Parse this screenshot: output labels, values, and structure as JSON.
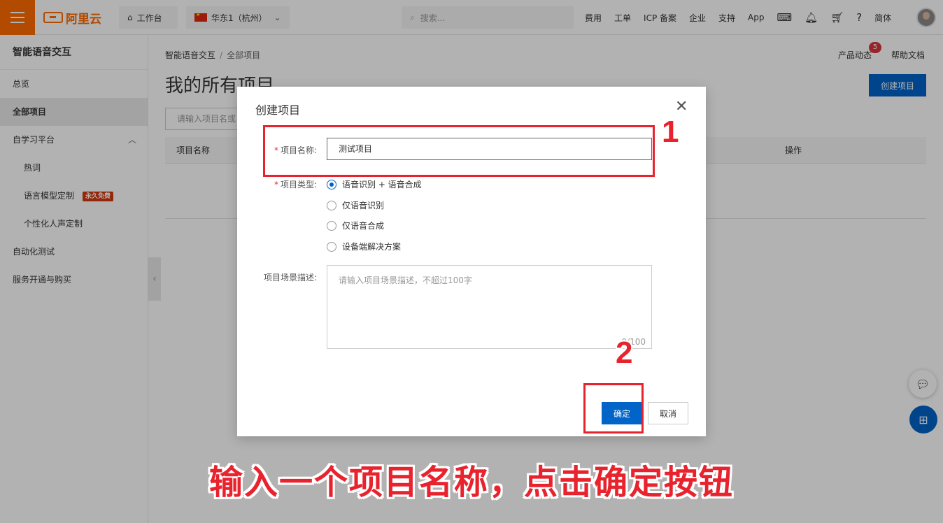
{
  "topbar": {
    "logo_text": "阿里云",
    "workbench": "工作台",
    "region": "华东1（杭州）",
    "search_placeholder": "搜索...",
    "nav": [
      "费用",
      "工单",
      "ICP 备案",
      "企业",
      "支持",
      "App"
    ],
    "lang": "简体"
  },
  "sidebar": {
    "title": "智能语音交互",
    "items": [
      {
        "label": "总览"
      },
      {
        "label": "全部项目"
      },
      {
        "label": "自学习平台"
      },
      {
        "label": "热词"
      },
      {
        "label": "语言模型定制",
        "badge": "永久免费"
      },
      {
        "label": "个性化人声定制"
      },
      {
        "label": "自动化测试"
      },
      {
        "label": "服务开通与购买"
      }
    ]
  },
  "main": {
    "breadcrumb": [
      "智能语音交互",
      "全部项目"
    ],
    "title": "我的所有项目",
    "notice_label": "产品动态",
    "notice_count": "5",
    "help_label": "帮助文档",
    "create_button": "创建项目",
    "filter_placeholder": "请输入项目名或",
    "columns": [
      "项目名称",
      "操作"
    ]
  },
  "dialog": {
    "title": "创建项目",
    "name_label": "项目名称:",
    "name_value": "测试项目",
    "type_label": "项目类型:",
    "type_options": [
      "语音识别 + 语音合成",
      "仅语音识别",
      "仅语音合成",
      "设备端解决方案"
    ],
    "type_selected": 0,
    "desc_label": "项目场景描述:",
    "desc_placeholder": "请输入项目场景描述，不超过100字",
    "desc_count": "0/100",
    "ok_button": "确定",
    "cancel_button": "取消"
  },
  "annotations": {
    "step1": "1",
    "step2": "2",
    "caption": "输入一个项目名称，点击确定按钮",
    "color": "#e8232e"
  }
}
